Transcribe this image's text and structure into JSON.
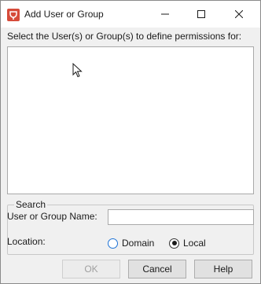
{
  "window": {
    "title": "Add User or Group",
    "icon": "app-logo-icon",
    "controls": [
      "minimize-icon",
      "maximize-icon",
      "close-icon"
    ]
  },
  "prompt": "Select the User(s) or Group(s) to define permissions for:",
  "list": {
    "items": []
  },
  "search": {
    "legend": "Search",
    "name_label": "User or Group Name:",
    "name_value": "",
    "location_label": "Location:",
    "options": [
      {
        "label": "Domain",
        "selected": false
      },
      {
        "label": "Local",
        "selected": true
      }
    ]
  },
  "buttons": {
    "ok": "OK",
    "cancel": "Cancel",
    "help": "Help"
  },
  "colors": {
    "app_icon": "#d64b3a",
    "focus_ring": "#1e73d6"
  }
}
